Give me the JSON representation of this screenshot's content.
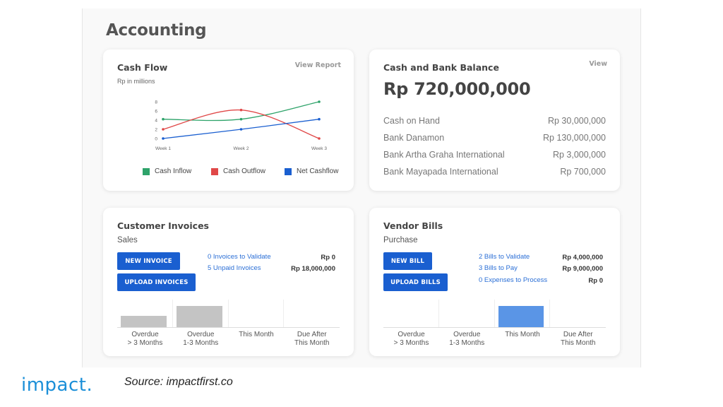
{
  "page_title": "Accounting",
  "cash_flow": {
    "title": "Cash Flow",
    "link": "View Report",
    "subtitle": "Rp in millions",
    "chart_data": {
      "type": "line",
      "x": [
        "Week 1",
        "Week 2",
        "Week 3"
      ],
      "ylim": [
        0,
        8
      ],
      "yticks": [
        "0",
        "2",
        "4",
        "6",
        "8"
      ],
      "grid": false,
      "legend": "bottom",
      "series": [
        {
          "name": "Cash Inflow",
          "color": "#2ea36a",
          "values": [
            4.2,
            4.2,
            8.0
          ]
        },
        {
          "name": "Cash Outflow",
          "color": "#e04848",
          "values": [
            2.0,
            6.2,
            0.0
          ]
        },
        {
          "name": "Net Cashflow",
          "color": "#1a5fd0",
          "values": [
            0.0,
            2.0,
            4.2
          ]
        }
      ]
    }
  },
  "bank_balance": {
    "title": "Cash and Bank Balance",
    "link": "View",
    "total": "Rp 720,000,000",
    "rows": [
      {
        "label": "Cash on Hand",
        "value": "Rp 30,000,000"
      },
      {
        "label": "Bank Danamon",
        "value": "Rp 130,000,000"
      },
      {
        "label": "Bank Artha Graha International",
        "value": "Rp 3,000,000"
      },
      {
        "label": "Bank Mayapada International",
        "value": "Rp 700,000"
      }
    ]
  },
  "customer_invoices": {
    "title": "Customer Invoices",
    "subtitle": "Sales",
    "button_primary": "NEW INVOICE",
    "button_secondary": "UPLOAD INVOICES",
    "statuses": [
      {
        "label": "0 Invoices to Validate",
        "amount": "Rp 0"
      },
      {
        "label": "5 Unpaid Invoices",
        "amount": "Rp 18,000,000"
      }
    ],
    "aging": [
      {
        "label1": "Overdue",
        "label2": "> 3 Months",
        "level": 0.4,
        "color": "#c4c4c4"
      },
      {
        "label1": "Overdue",
        "label2": "1-3 Months",
        "level": 0.78,
        "color": "#c4c4c4"
      },
      {
        "label1": "This Month",
        "label2": "",
        "level": 0,
        "color": "#c4c4c4"
      },
      {
        "label1": "Due After",
        "label2": "This Month",
        "level": 0,
        "color": "#c4c4c4"
      }
    ]
  },
  "vendor_bills": {
    "title": "Vendor Bills",
    "subtitle": "Purchase",
    "button_primary": "NEW BILL",
    "button_secondary": "UPLOAD BILLS",
    "statuses": [
      {
        "label": "2 Bills to Validate",
        "amount": "Rp 4,000,000"
      },
      {
        "label": "3 Bills to Pay",
        "amount": "Rp 9,000,000"
      },
      {
        "label": "0 Expenses to Process",
        "amount": "Rp 0"
      }
    ],
    "aging": [
      {
        "label1": "Overdue",
        "label2": "> 3 Months",
        "level": 0,
        "color": "#5a95e6"
      },
      {
        "label1": "Overdue",
        "label2": "1-3 Months",
        "level": 0,
        "color": "#5a95e6"
      },
      {
        "label1": "This Month",
        "label2": "",
        "level": 0.78,
        "color": "#5a95e6"
      },
      {
        "label1": "Due After",
        "label2": "This Month",
        "level": 0,
        "color": "#5a95e6"
      }
    ]
  },
  "footer": {
    "logo": "impact.",
    "source": "Source: impactfirst.co"
  }
}
